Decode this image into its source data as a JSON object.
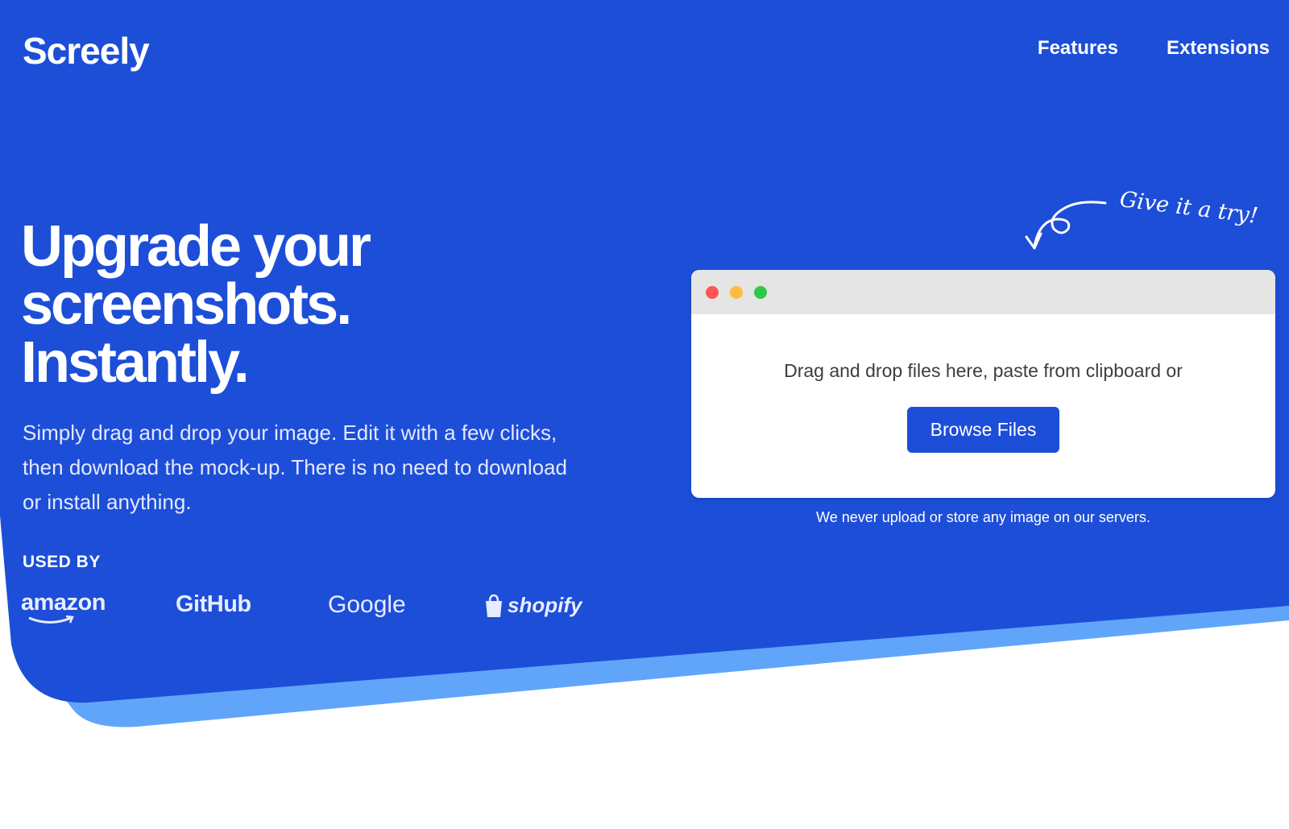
{
  "brand": {
    "name": "Screely"
  },
  "nav": {
    "features": "Features",
    "extensions": "Extensions"
  },
  "hero": {
    "line1": "Upgrade your",
    "line2": "screenshots.",
    "line3": "Instantly.",
    "subtext": "Simply drag and drop your image. Edit it with a few clicks, then download the mock-up. There is no need to download or install anything.",
    "used_by": "USED BY"
  },
  "logos": {
    "amazon": "amazon",
    "github": "GitHub",
    "google": "Google",
    "shopify": "shopify"
  },
  "hint": "Give it a try!",
  "upload": {
    "drop_text": "Drag and drop files here, paste from clipboard or",
    "button": "Browse Files",
    "privacy": "We never upload or store any image on our servers."
  },
  "colors": {
    "primary_blue": "#1d4ed8",
    "light_blue": "#60a5fa",
    "dot_red": "#fc5753",
    "dot_yellow": "#fdbc40",
    "dot_green": "#33c748"
  }
}
